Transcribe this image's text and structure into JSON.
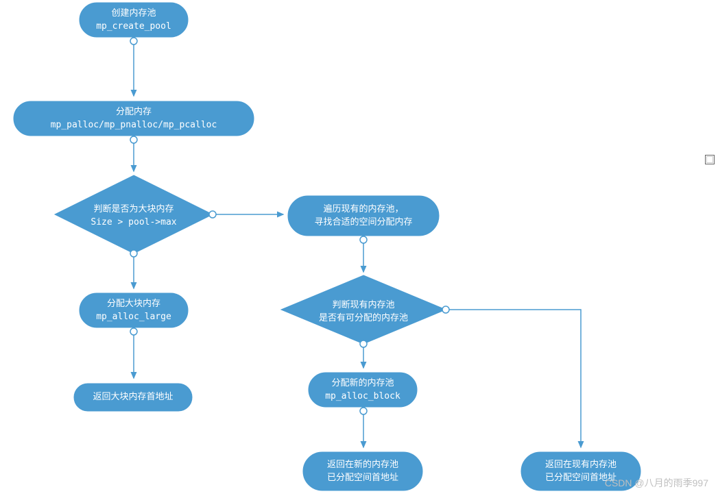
{
  "nodes": {
    "create": {
      "line1": "创建内存池",
      "line2": "mp_create_pool"
    },
    "alloc": {
      "line1": "分配内存",
      "line2": "mp_palloc/mp_pnalloc/mp_pcalloc"
    },
    "decision_size": {
      "line1": "判断是否为大块内存",
      "line2": "Size > pool->max"
    },
    "alloc_large": {
      "line1": "分配大块内存",
      "line2": "mp_alloc_large"
    },
    "return_large": {
      "line1": "返回大块内存首地址"
    },
    "traverse": {
      "line1": "遍历现有的内存池，",
      "line2": "寻找合适的空间分配内存"
    },
    "decision_pool": {
      "line1": "判断现有内存池",
      "line2": "是否有可分配的内存池"
    },
    "alloc_block": {
      "line1": "分配新的内存池",
      "line2": "mp_alloc_block"
    },
    "return_new": {
      "line1": "返回在新的内存池",
      "line2": "已分配空间首地址"
    },
    "return_exist": {
      "line1": "返回在现有内存池",
      "line2": "已分配空间首地址"
    }
  },
  "watermark": "CSDN @八月的雨季997"
}
